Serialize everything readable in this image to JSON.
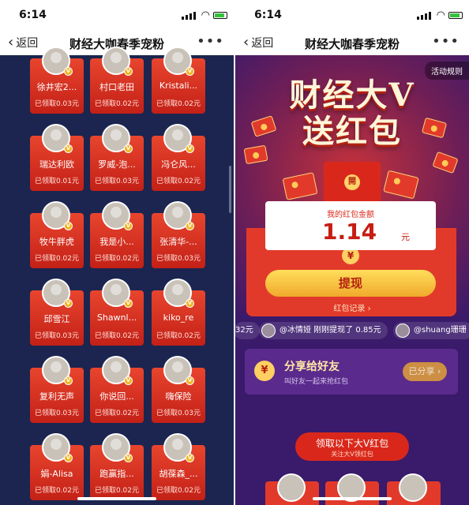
{
  "status_bar": {
    "time": "6:14"
  },
  "left": {
    "nav": {
      "back_label": "返回",
      "title": "财经大咖春季宠粉"
    },
    "cards": [
      {
        "name": "徐井宏2...",
        "amount": "已领取0.03元"
      },
      {
        "name": "村口老田",
        "amount": "已领取0.02元"
      },
      {
        "name": "Kristali...",
        "amount": "已领取0.02元"
      },
      {
        "name": "瑞达利欧",
        "amount": "已领取0.01元"
      },
      {
        "name": "罗威-泡...",
        "amount": "已领取0.03元"
      },
      {
        "name": "冯仑风...",
        "amount": "已领取0.02元"
      },
      {
        "name": "牧牛胖虎",
        "amount": "已领取0.02元"
      },
      {
        "name": "我是小...",
        "amount": "已领取0.02元"
      },
      {
        "name": "张清华-...",
        "amount": "已领取0.03元"
      },
      {
        "name": "邱雪江",
        "amount": "已领取0.03元"
      },
      {
        "name": "Shawnl...",
        "amount": "已领取0.02元"
      },
      {
        "name": "kiko_re",
        "amount": "已领取0.02元"
      },
      {
        "name": "复利无声",
        "amount": "已领取0.03元"
      },
      {
        "name": "你说回...",
        "amount": "已领取0.02元"
      },
      {
        "name": "嗨保险",
        "amount": "已领取0.03元"
      },
      {
        "name": "娟-Alisa",
        "amount": "已领取0.02元"
      },
      {
        "name": "跑赢指...",
        "amount": "已领取0.02元"
      },
      {
        "name": "胡葆森_...",
        "amount": "已领取0.02元"
      }
    ]
  },
  "right": {
    "nav": {
      "back_label": "返回",
      "title": "财经大咖春季宠粉"
    },
    "rules_label": "活动规则",
    "headline_line1": "财经大V",
    "headline_line2": "送红包",
    "open_label": "開",
    "amount_label": "我的红包金额",
    "amount_value": "1.14",
    "amount_unit": "元",
    "withdraw_label": "提现",
    "record_label": "红包记录 ›",
    "ticker": [
      {
        "text": "32元"
      },
      {
        "text": "@冰情娅 刚刚提现了 0.85元"
      },
      {
        "text": "@shuang珊珊"
      }
    ],
    "share": {
      "title": "分享给好友",
      "subtitle": "叫好友一起来抢红包",
      "button": "已分享 ›"
    },
    "receive": {
      "title": "领取以下大V红包",
      "subtitle": "关注大V领红包"
    }
  },
  "colors": {
    "accent_red": "#e23a2a",
    "gold": "#ffcf62",
    "navy": "#1b2550",
    "purple": "#3a1a6b"
  },
  "icons": [
    "back-chevron-icon",
    "more-icon",
    "verified-v-icon",
    "yen-icon",
    "envelope-icon"
  ]
}
